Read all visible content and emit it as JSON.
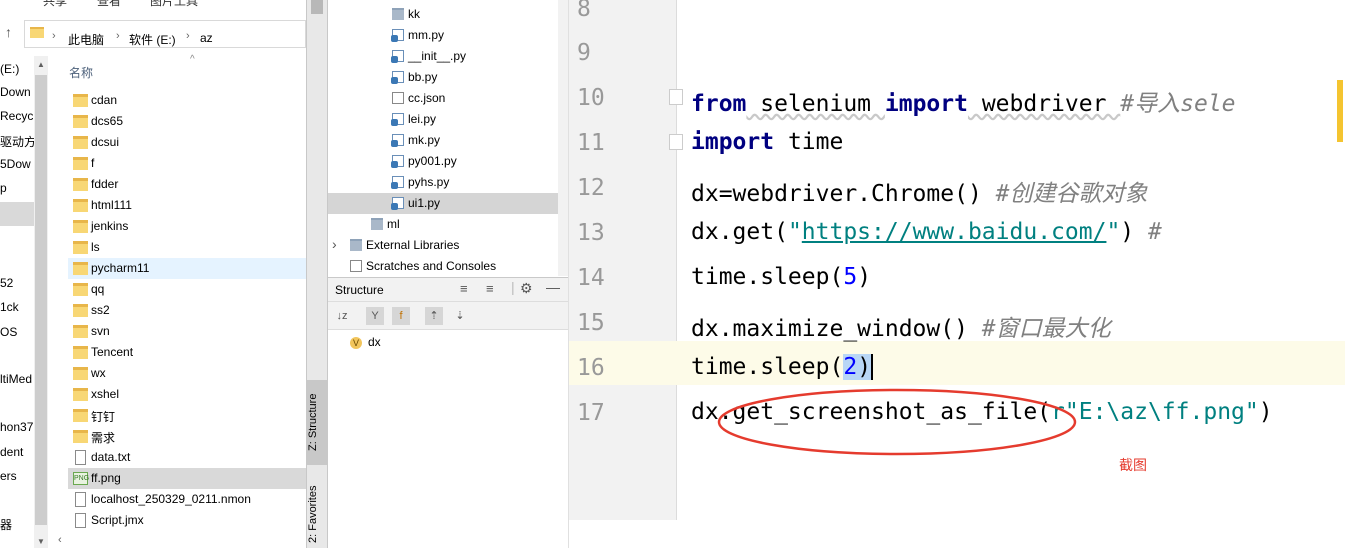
{
  "explorer": {
    "ribbon": {
      "share": "共享",
      "view": "查看",
      "picture_tools": "图片工具"
    },
    "breadcrumb": [
      "此电脑",
      "软件 (E:)",
      "az"
    ],
    "column_header": "名称",
    "nav_items": [
      "(E:)",
      "Down",
      "Recyc",
      "驱动方",
      "5Dow",
      "p",
      "",
      "52",
      "1ck",
      "OS",
      "ltiMed",
      "hon37",
      "dent",
      "ers",
      "器"
    ],
    "files": [
      {
        "name": "cdan",
        "type": "folder"
      },
      {
        "name": "dcs65",
        "type": "folder"
      },
      {
        "name": "dcsui",
        "type": "folder"
      },
      {
        "name": "f",
        "type": "folder"
      },
      {
        "name": "fdder",
        "type": "folder"
      },
      {
        "name": "html111",
        "type": "folder"
      },
      {
        "name": "jenkins",
        "type": "folder"
      },
      {
        "name": "ls",
        "type": "folder"
      },
      {
        "name": "pycharm11",
        "type": "folder"
      },
      {
        "name": "qq",
        "type": "folder"
      },
      {
        "name": "ss2",
        "type": "folder"
      },
      {
        "name": "svn",
        "type": "folder"
      },
      {
        "name": "Tencent",
        "type": "folder"
      },
      {
        "name": "wx",
        "type": "folder"
      },
      {
        "name": "xshel",
        "type": "folder"
      },
      {
        "name": "钉钉",
        "type": "folder"
      },
      {
        "name": "需求",
        "type": "folder"
      },
      {
        "name": "data.txt",
        "type": "file"
      },
      {
        "name": "ff.png",
        "type": "png"
      },
      {
        "name": "localhost_250329_0211.nmon",
        "type": "file"
      },
      {
        "name": "Script.jmx",
        "type": "file"
      }
    ]
  },
  "ide": {
    "side_tabs": {
      "structure": "Z: Structure",
      "favorites": "2: Favorites"
    },
    "project_tree": [
      {
        "name": "kk",
        "type": "dir"
      },
      {
        "name": "mm.py",
        "type": "py"
      },
      {
        "name": "__init__.py",
        "type": "py"
      },
      {
        "name": "bb.py",
        "type": "py"
      },
      {
        "name": "cc.json",
        "type": "json"
      },
      {
        "name": "lei.py",
        "type": "py"
      },
      {
        "name": "mk.py",
        "type": "py"
      },
      {
        "name": "py001.py",
        "type": "py"
      },
      {
        "name": "pyhs.py",
        "type": "py"
      },
      {
        "name": "ui1.py",
        "type": "py"
      },
      {
        "name": "ml",
        "type": "dir"
      },
      {
        "name": "External Libraries",
        "type": "lib"
      },
      {
        "name": "Scratches and Consoles",
        "type": "scratch"
      }
    ],
    "structure_panel": {
      "title": "Structure",
      "item": "dx",
      "item_badge": "V"
    },
    "editor": {
      "line_numbers": [
        "8",
        "9",
        "10",
        "11",
        "12",
        "13",
        "14",
        "15",
        "16",
        "17"
      ],
      "lines": {
        "l10": {
          "kw1": "from",
          "mod": " selenium ",
          "kw2": "import",
          "name": " webdriver ",
          "comment": "#导入sele"
        },
        "l11": {
          "kw": "import",
          "name": " time"
        },
        "l12": {
          "code": "dx=webdriver.Chrome() ",
          "comment": "#创建谷歌对象"
        },
        "l13": {
          "pre": "dx.get(",
          "q1": "\"",
          "url": "https://www.baidu.com/",
          "q2": "\"",
          "post": ") ",
          "comment": "#"
        },
        "l14": {
          "pre": "time.sleep(",
          "num": "5",
          "post": ")"
        },
        "l15": {
          "code": "dx.maximize_window() ",
          "comment": "#窗口最大化"
        },
        "l16": {
          "pre": "time.sleep(",
          "num": "2",
          "post": ")"
        },
        "l17": {
          "pre": "dx.get_screenshot_as_file(",
          "str": "r\"E:\\az\\ff.png\"",
          "post": ")"
        }
      },
      "annotation": "截图",
      "annotation_color": "#e53b2e"
    }
  }
}
